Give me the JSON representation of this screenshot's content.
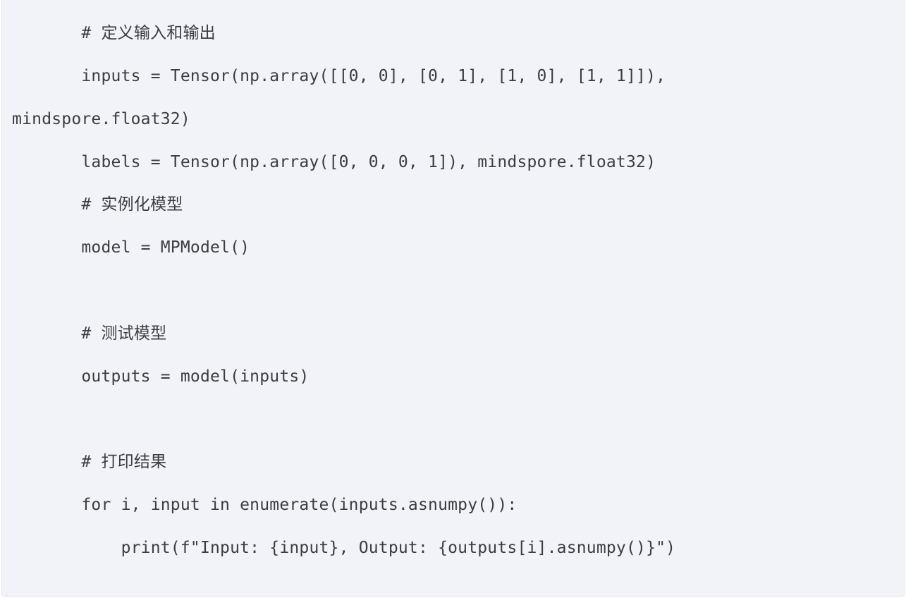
{
  "code": {
    "lines": [
      "        # 定义输入和输出",
      "        inputs = Tensor(np.array([[0, 0], [0, 1], [1, 0], [1, 1]]),",
      " mindspore.float32)",
      "        labels = Tensor(np.array([0, 0, 0, 1]), mindspore.float32)",
      "        # 实例化模型",
      "        model = MPModel()",
      "",
      "        # 测试模型",
      "        outputs = model(inputs)",
      "",
      "        # 打印结果",
      "        for i, input in enumerate(inputs.asnumpy()):",
      "            print(f\"Input: {input}, Output: {outputs[i].asnumpy()}\")"
    ]
  }
}
